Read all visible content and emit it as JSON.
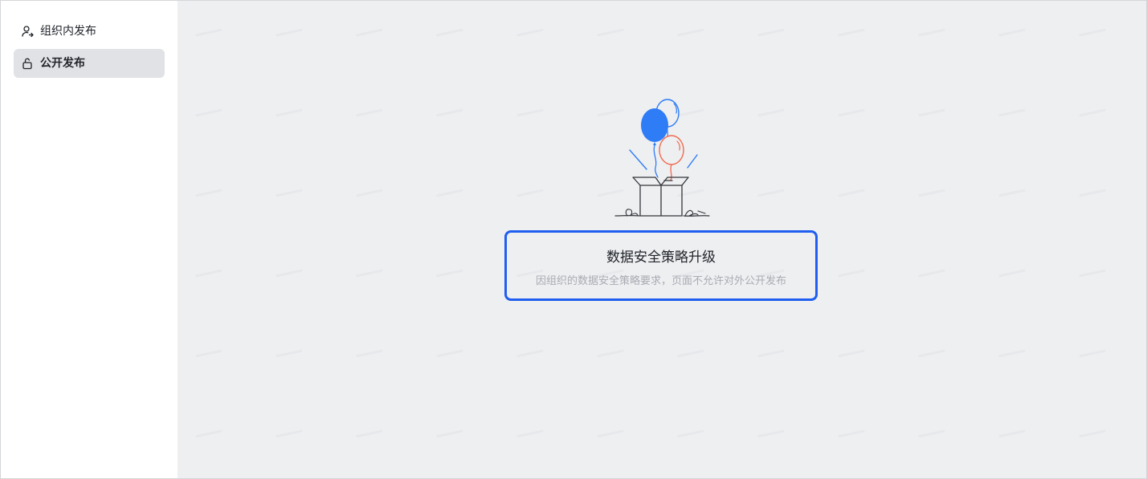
{
  "sidebar": {
    "items": [
      {
        "label": "组织内发布",
        "icon": "user-share-icon",
        "active": false
      },
      {
        "label": "公开发布",
        "icon": "unlock-icon",
        "active": true
      }
    ]
  },
  "main": {
    "title": "数据安全策略升级",
    "description": "因组织的数据安全策略要求，页面不允许对外公开发布",
    "illustration": "balloons-gift-box-illustration"
  },
  "colors": {
    "accent": "#1f5ef0",
    "balloon_blue": "#2e7cf6",
    "balloon_red": "#f06a4f",
    "main_bg": "#eeeff1",
    "active_item_bg": "#e1e2e5"
  }
}
